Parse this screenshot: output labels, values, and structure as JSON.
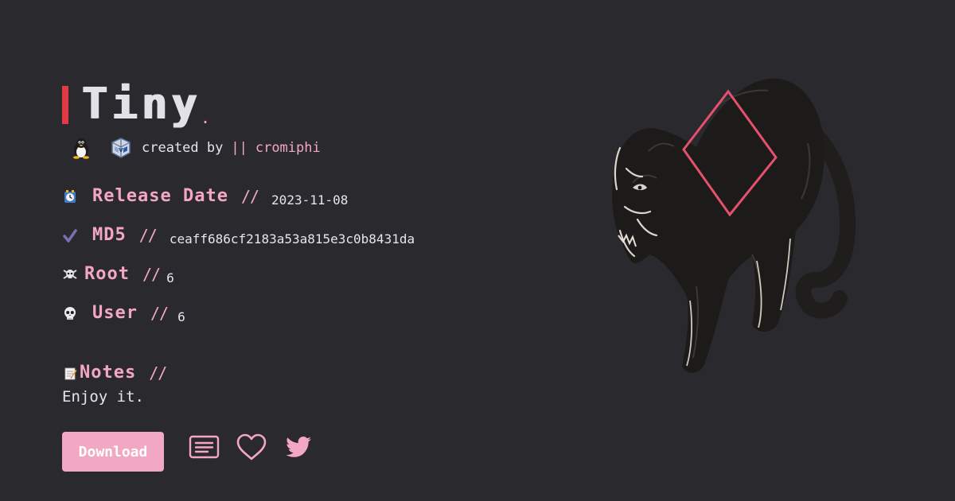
{
  "title": "Tiny",
  "title_dot": ".",
  "creator": {
    "prefix": "created by",
    "separator": "||",
    "name": "cromiphi"
  },
  "icons": {
    "os": "linux-penguin-icon",
    "hypervisor": "virtualbox-icon",
    "release": "clock-icon",
    "md5": "check-mark-icon",
    "root": "skull-crossbones-icon",
    "user": "skull-icon",
    "notes": "memo-icon",
    "writeup": "list-document-icon",
    "favorite": "heart-icon",
    "share": "twitter-bird-icon",
    "illustration": "black-panther-illustration"
  },
  "meta": {
    "separator": "//",
    "release_date_label": "Release Date",
    "release_date_value": "2023-11-08",
    "md5_label": "MD5",
    "md5_value": "ceaff686cf2183a53a815e3c0b8431da",
    "root_label": "Root",
    "root_value": "6",
    "user_label": "User",
    "user_value": "6"
  },
  "notes": {
    "label": "Notes",
    "separator": "//",
    "text": "Enjoy it."
  },
  "download_label": "Download",
  "colors": {
    "background": "#2a292e",
    "accent_pink": "#f3a7c4",
    "title_bar_red": "#e23947",
    "diamond_pink": "#e5506e"
  }
}
